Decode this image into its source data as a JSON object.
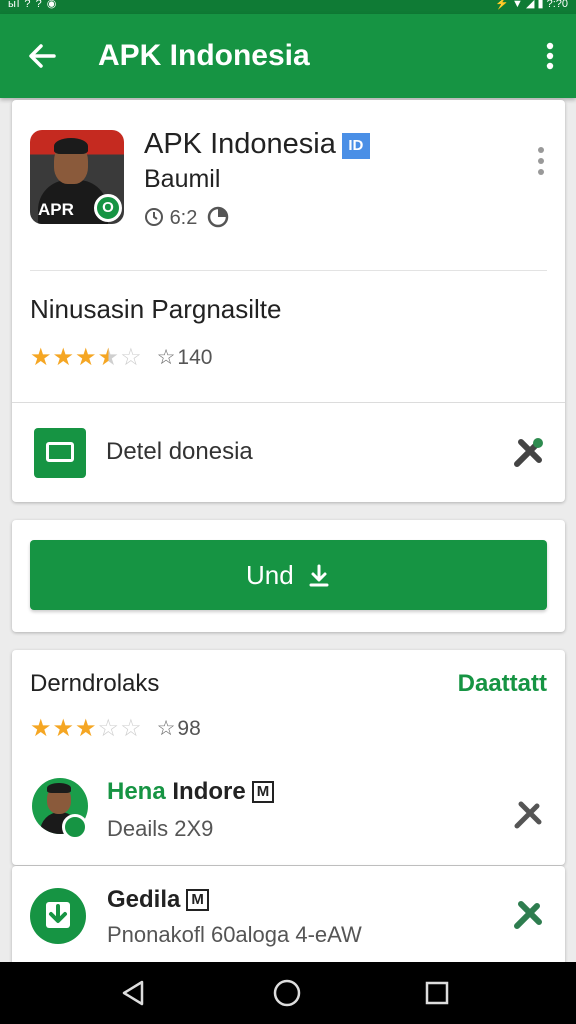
{
  "status_bar": {
    "left": "ыl ? ? ◉",
    "right": "⚡ ▼ ◢ ▮ ?:?0"
  },
  "app_bar": {
    "title": "APK Indonesia"
  },
  "app_card": {
    "name": "APK Indonesia",
    "verified_badge": "ID",
    "subtitle": "Baumil",
    "meta": "6:2",
    "icon_text": "APR",
    "icon_badge": "O",
    "section_title": "Ninusasin Pargnasilte",
    "rating": 3.5,
    "rating_count": "140",
    "detail_label": "Detel donesia"
  },
  "install": {
    "label": "Und"
  },
  "reviews": {
    "title": "Derndrolaks",
    "link": "Daattatt",
    "rating": 3.0,
    "rating_count": "98",
    "items": [
      {
        "name_green": "Hena",
        "name_rest": "Indore",
        "badge": "M",
        "sub": "Deails 2X9"
      },
      {
        "name_green": "",
        "name_rest": "Gedila",
        "badge": "M",
        "sub": "Pnonakofl 60aloga 4-eAW"
      }
    ]
  },
  "colors": {
    "primary": "#169443",
    "accent_star": "#f5a623",
    "verified": "#4a8fe6"
  },
  "icons": [
    "back-arrow-icon",
    "more-vert-icon",
    "clock-icon",
    "chart-icon",
    "star-icon",
    "detail-icon",
    "tools-icon",
    "download-icon",
    "nav-back-icon",
    "nav-home-icon",
    "nav-recents-icon"
  ]
}
